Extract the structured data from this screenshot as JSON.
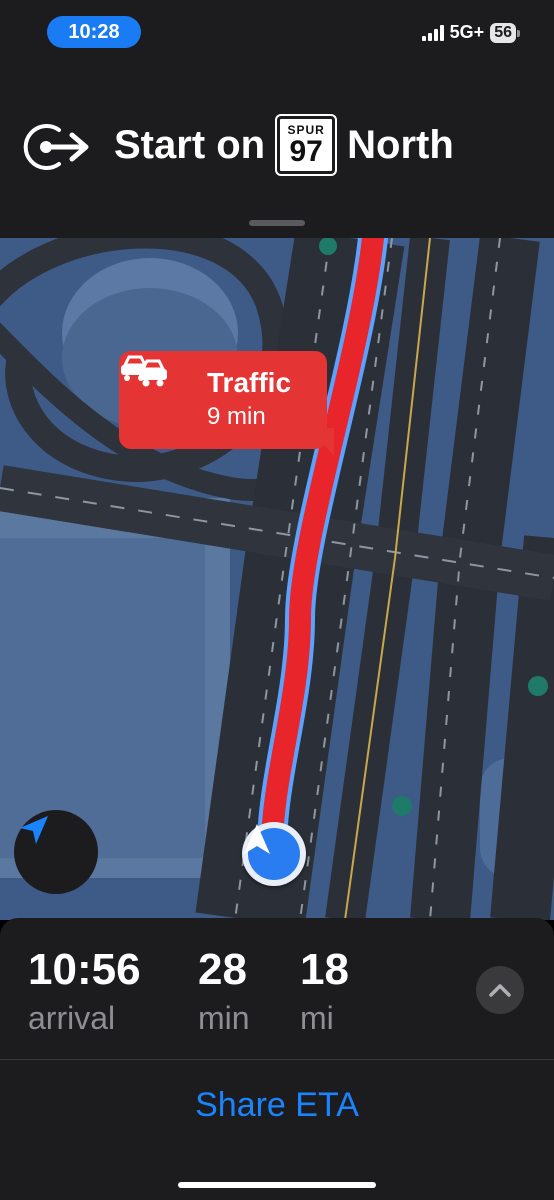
{
  "status_bar": {
    "time": "10:28",
    "network": "5G+",
    "battery": "56"
  },
  "instruction": {
    "text_before": "Start on",
    "route_shield": {
      "top": "SPUR",
      "number": "97"
    },
    "text_after": "North",
    "icon": "start-route-icon"
  },
  "map": {
    "traffic_callout": {
      "title": "Traffic",
      "subtitle": "9 min",
      "icon": "traffic-cars-icon"
    },
    "locate_icon": "location-arrow-icon",
    "puck_icon": "navigation-arrow-icon",
    "route_color": "#e8252b",
    "route_edge_color": "#5ba2ff"
  },
  "trip": {
    "arrival": {
      "value": "10:56",
      "label": "arrival"
    },
    "duration": {
      "value": "28",
      "label": "min"
    },
    "distance": {
      "value": "18",
      "label": "mi"
    },
    "expand_icon": "chevron-up-icon"
  },
  "share": {
    "label": "Share ETA"
  },
  "colors": {
    "accent": "#1a84ff",
    "traffic": "#e53434",
    "panel": "#1c1c1e",
    "map_ground": "#3e5a86"
  }
}
